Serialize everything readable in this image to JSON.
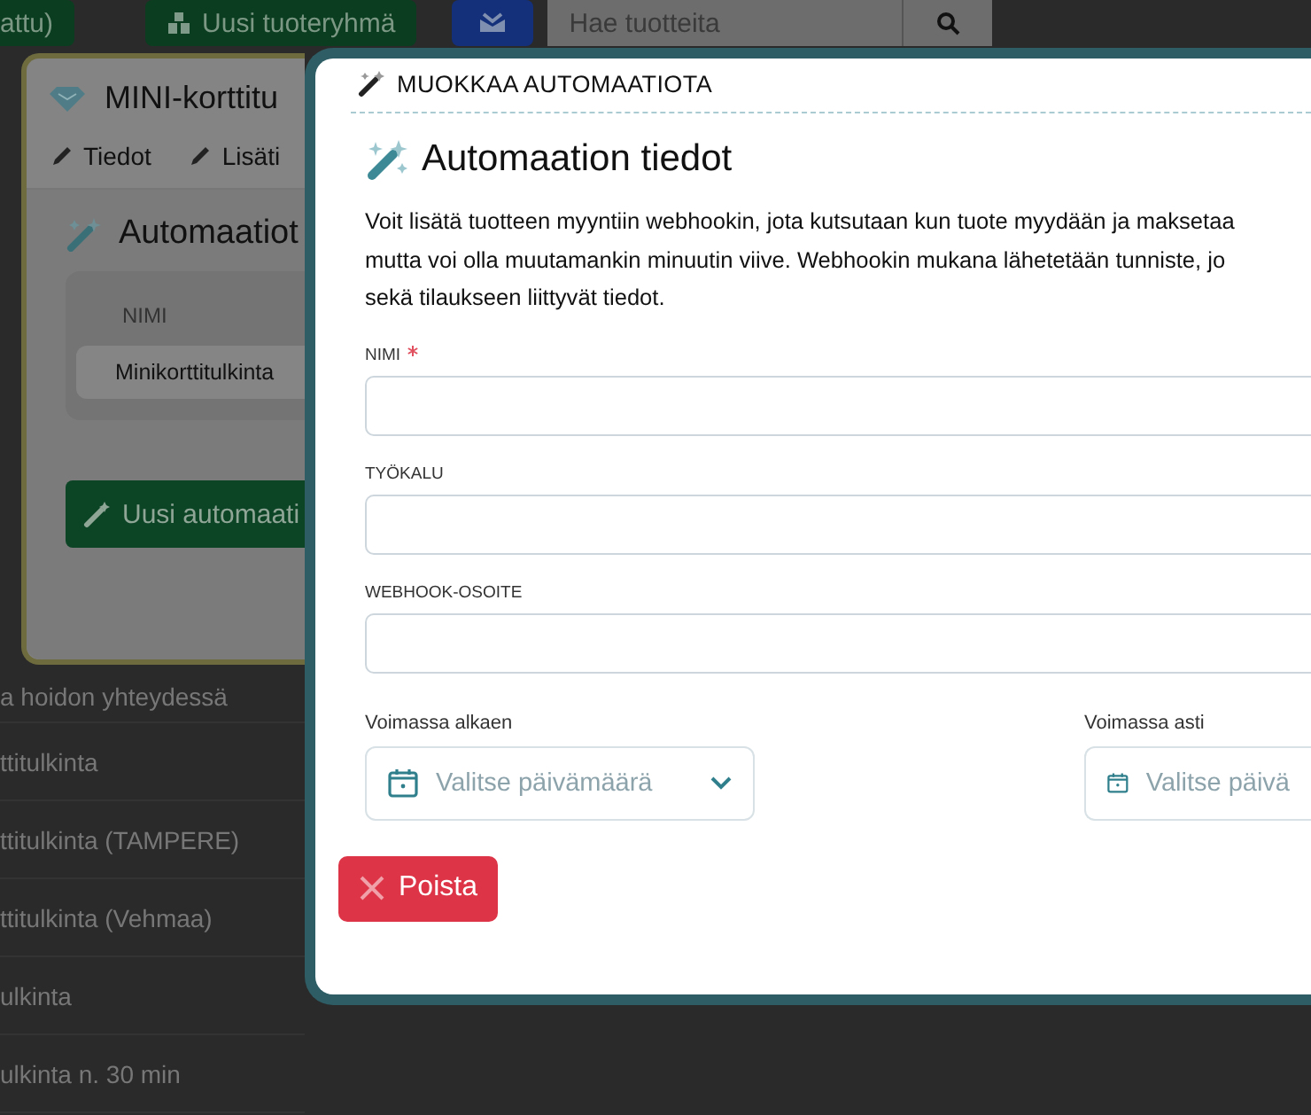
{
  "top_bar": {
    "save_label": "attu)",
    "new_group_button": "Uusi tuoteryhmä",
    "search": {
      "placeholder": "Hae tuotteita"
    }
  },
  "background_list": {
    "rows": [
      "a hoidon yhteydessä",
      "ttitulkinta",
      "ttitulkinta (TAMPERE)",
      "ttitulkinta (Vehmaa)",
      "ulkinta",
      "ulkinta n. 30 min"
    ]
  },
  "product_modal": {
    "title": "MINI-korttitu",
    "tabs": [
      {
        "label": "Tiedot"
      },
      {
        "label": "Lisäti"
      }
    ],
    "section_title": "Automaatiot",
    "table": {
      "columns": [
        "NIMI"
      ],
      "rows": [
        "Minikorttitulkinta"
      ]
    },
    "new_button": "Uusi automaati"
  },
  "edit_modal": {
    "title": "MUOKKAA AUTOMAATIOTA",
    "heading": "Automaation tiedot",
    "description_lines": [
      "Voit lisätä tuotteen myyntiin webhookin, jota kutsutaan kun tuote myydään ja maksetaa",
      "mutta voi olla muutamankin minuutin viive. Webhookin mukana lähetetään tunniste, jo",
      "sekä tilaukseen liittyvät tiedot."
    ],
    "fields": [
      {
        "label": "NIMI",
        "required": true
      },
      {
        "label": "TYÖKALU",
        "required": false
      },
      {
        "label": "WEBHOOK-OSOITE",
        "required": false
      }
    ],
    "dates": [
      {
        "label": "Voimassa alkaen",
        "placeholder": "Valitse päivämäärä",
        "dropdown": true
      },
      {
        "label": "Voimassa asti",
        "placeholder": "Valitse päivä",
        "dropdown": false
      }
    ],
    "delete_button": "Poista"
  }
}
